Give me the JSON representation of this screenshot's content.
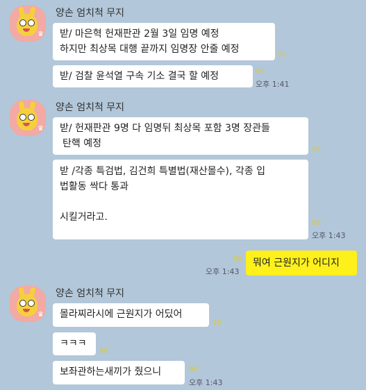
{
  "sender_name": "양손 엄치척 무지",
  "avatar_icon": "muzi-avatar-icon",
  "crown_glyph": "♛",
  "colors": {
    "background": "#b2c7d9",
    "my_bubble": "#fef01b",
    "other_bubble": "#ffffff",
    "unread": "#d8c94a"
  },
  "groups": [
    {
      "name": "양손 엄치척 무지",
      "messages": [
        {
          "lines": [
            "받/ 마은혁 헌재판관 2월 3일 임명 예정",
            "하지만 최상목 대행 끝까지 임명장 안줄 예정"
          ],
          "unread": "99",
          "time": ""
        },
        {
          "lines": [
            "받/ 검찰 윤석열 구속 기소 결국 할 예정"
          ],
          "unread": "99",
          "time": "오후 1:41"
        }
      ]
    },
    {
      "name": "양손 엄치척 무지",
      "messages": [
        {
          "lines": [
            "받/ 헌재판관 9명 다 임명뒤 최상목 포함 3명 장관들",
            "탄핵 예정"
          ],
          "unread": "99",
          "time": ""
        },
        {
          "lines": [
            "받 /각종 특검법, 김건희 특별법(재산몰수), 각종 입",
            "법활동 싹다 통과",
            "",
            "시킬거라고."
          ],
          "unread": "99",
          "time": "오후 1:43"
        }
      ]
    },
    {
      "mine": true,
      "messages": [
        {
          "lines": [
            "뭐여 근원지가 어디지"
          ],
          "unread": "99",
          "time": "오후 1:43"
        }
      ]
    },
    {
      "name": "양손 엄치척 무지",
      "messages": [
        {
          "lines": [
            "몰라찌라시에 근원지가 어딨어"
          ],
          "unread": "99",
          "time": ""
        },
        {
          "lines": [
            "ㅋㅋㅋ"
          ],
          "unread": "99",
          "time": ""
        },
        {
          "lines": [
            "보좌관하는새끼가 줬으니"
          ],
          "unread": "99",
          "time": "오후 1:43"
        }
      ]
    }
  ]
}
